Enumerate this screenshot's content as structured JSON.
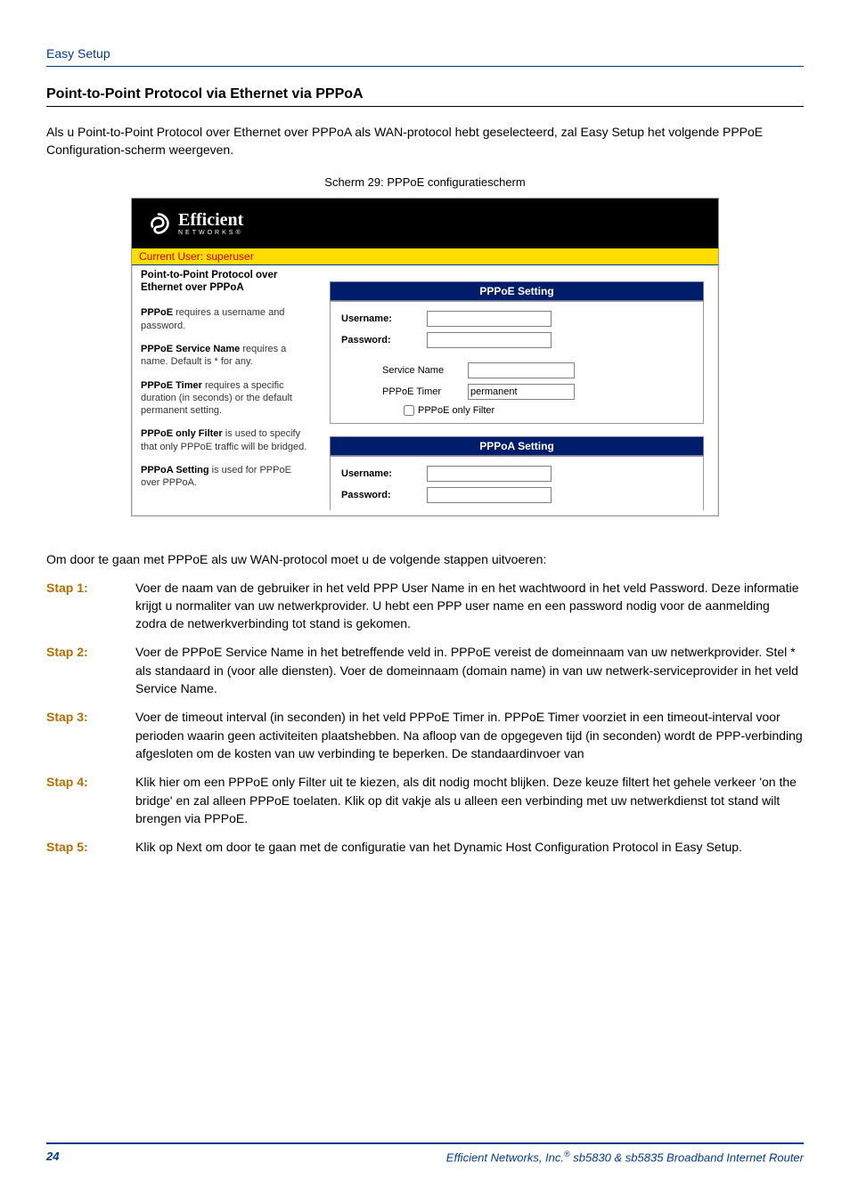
{
  "header": {
    "label": "Easy Setup"
  },
  "section": {
    "title": "Point-to-Point Protocol via Ethernet via PPPoA",
    "intro": "Als u Point-to-Point Protocol over Ethernet over PPPoA als WAN-protocol hebt geselecteerd, zal Easy Setup het volgende PPPoE Configuration-scherm weergeven.",
    "caption": "Scherm 29: PPPoE configuratiescherm"
  },
  "screenshot": {
    "logo": {
      "brand": "Efficient",
      "sub": "NETWORKS®"
    },
    "current_user": "Current User: superuser",
    "left": {
      "protocol_title": "Point-to-Point Protocol over Ethernet over PPPoA",
      "p1_b": "PPPoE",
      "p1": " requires a username and password.",
      "p2_b": "PPPoE Service Name",
      "p2": " requires a name. Default is * for any.",
      "p3_b": "PPPoE Timer",
      "p3": " requires a specific duration (in seconds) or the default permanent setting.",
      "p4_b": "PPPoE only Filter",
      "p4": " is used to specify that only PPPoE traffic will be bridged.",
      "p5_b": "PPPoA Setting",
      "p5": " is used for PPPoE over PPPoA."
    },
    "pppoe": {
      "header": "PPPoE Setting",
      "username_label": "Username:",
      "password_label": "Password:",
      "service_label": "Service Name",
      "timer_label": "PPPoE Timer",
      "timer_value": "permanent",
      "filter_label": "PPPoE only Filter"
    },
    "pppoa": {
      "header": "PPPoA Setting",
      "username_label": "Username:",
      "password_label": "Password:"
    }
  },
  "proceed": "Om door te gaan met PPPoE als uw WAN-protocol moet u de volgende stappen uitvoeren:",
  "steps": [
    {
      "label": "Stap 1:",
      "text": "Voer de naam van de gebruiker in het veld PPP User Name in en het wachtwoord in het veld Password. Deze informatie krijgt u normaliter van uw netwerkprovider. U hebt een PPP user name en een password nodig voor de aanmelding zodra de netwerkverbinding tot stand is gekomen."
    },
    {
      "label": "Stap 2:",
      "text": "Voer de PPPoE Service Name in het betreffende veld in. PPPoE vereist de domeinnaam van uw netwerkprovider. Stel * als standaard in (voor alle diensten). Voer de domeinnaam (domain name) in van uw netwerk-serviceprovider in het veld Service Name."
    },
    {
      "label": "Stap 3:",
      "text": "Voer de timeout interval (in seconden) in het veld PPPoE Timer in. PPPoE Timer voorziet in een timeout-interval voor perioden waarin geen activiteiten plaatshebben. Na afloop van de opgegeven tijd (in seconden) wordt de PPP-verbinding afgesloten om de kosten van uw verbinding te beperken. De standaardinvoer van"
    },
    {
      "label": "Stap 4:",
      "text": "Klik hier om een PPPoE only Filter uit te kiezen, als dit nodig mocht blijken. Deze keuze filtert het gehele verkeer 'on the bridge' en zal alleen PPPoE toelaten. Klik op dit vakje als u alleen een verbinding met uw netwerkdienst tot stand wilt brengen via PPPoE."
    },
    {
      "label": "Stap 5:",
      "text": "Klik op Next om door te gaan met de configuratie van het Dynamic Host Configuration Protocol in Easy Setup."
    }
  ],
  "footer": {
    "page": "24",
    "text_prefix": "Efficient Networks, Inc.",
    "reg": "®",
    "text_suffix": " sb5830 & sb5835 Broadband Internet Router"
  }
}
